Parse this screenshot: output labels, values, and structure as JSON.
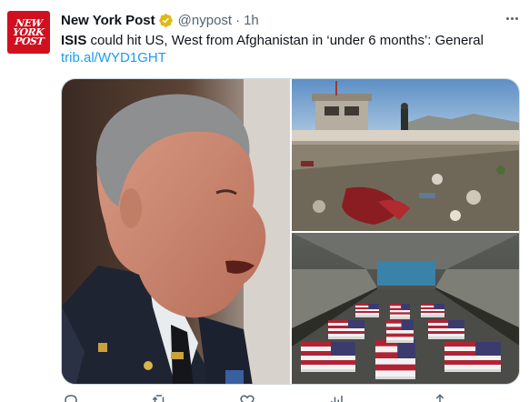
{
  "tweet": {
    "author_name": "New York Post",
    "handle": "@nypost",
    "separator": "·",
    "time": "1h",
    "avatar_logo": [
      "NEW",
      "YORK",
      "POST"
    ],
    "text_bold": "ISIS",
    "text_rest": " could hit US, West from Afghanistan in ‘under 6 months’: General",
    "link": "trib.al/WYD1GHT"
  },
  "media": {
    "image_left": "general-speaking-photo",
    "image_top_right": "airport-wall-debris-photo",
    "image_bottom_right": "flag-draped-coffins-aircraft-photo"
  },
  "icons": {
    "verified": "verified-badge-icon",
    "more": "more-options-icon",
    "reply": "reply-icon",
    "retweet": "retweet-icon",
    "like": "like-icon",
    "views": "views-icon",
    "share": "share-icon"
  },
  "colors": {
    "brand_red": "#d0101f",
    "link_blue": "#1d9bf0",
    "verified_gold": "#e2b719",
    "secondary_text": "#536471"
  }
}
